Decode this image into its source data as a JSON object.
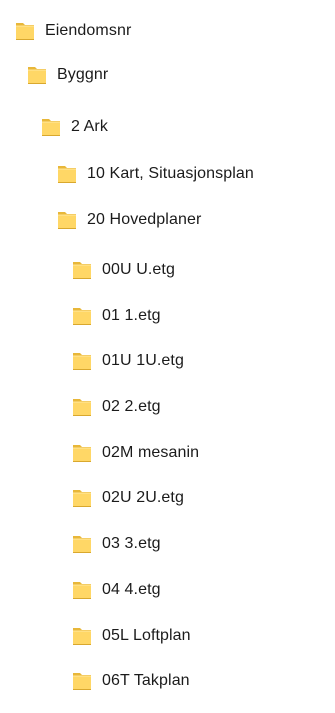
{
  "tree": {
    "items": [
      {
        "label": "Eiendomsnr",
        "icon": "folder-icon"
      },
      {
        "label": "Byggnr",
        "icon": "folder-icon"
      },
      {
        "label": "2 Ark",
        "icon": "folder-icon"
      },
      {
        "label": "10 Kart, Situasjonsplan",
        "icon": "folder-icon"
      },
      {
        "label": "20 Hovedplaner",
        "icon": "folder-icon"
      },
      {
        "label": "00U U.etg",
        "icon": "folder-icon"
      },
      {
        "label": "01 1.etg",
        "icon": "folder-icon"
      },
      {
        "label": "01U 1U.etg",
        "icon": "folder-icon"
      },
      {
        "label": "02 2.etg",
        "icon": "folder-icon"
      },
      {
        "label": "02M mesanin",
        "icon": "folder-icon"
      },
      {
        "label": "02U 2U.etg",
        "icon": "folder-icon"
      },
      {
        "label": "03 3.etg",
        "icon": "folder-icon"
      },
      {
        "label": "04 4.etg",
        "icon": "folder-icon"
      },
      {
        "label": "05L Loftplan",
        "icon": "folder-icon"
      },
      {
        "label": "06T Takplan",
        "icon": "folder-icon"
      }
    ]
  },
  "colors": {
    "folder_body": "#ffd766",
    "folder_back": "#e8b739",
    "folder_edge": "#d9a82e",
    "text": "#1b1b1b"
  }
}
